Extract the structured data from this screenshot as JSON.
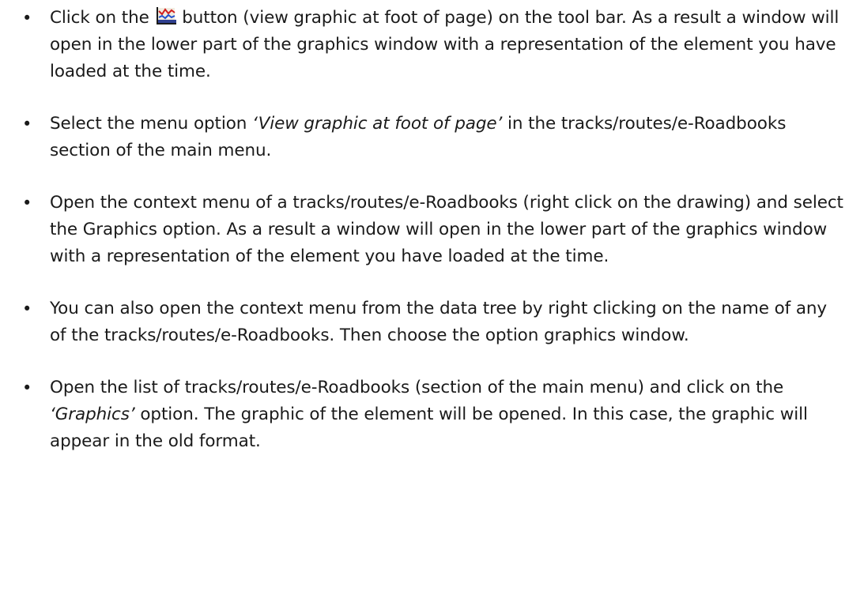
{
  "bullet_char": "•",
  "items": [
    {
      "a": "Click on the ",
      "icon": "graphic-profile-icon",
      "b": " button (view graphic at foot of page) on the tool bar. As a result a window will open in the lower part of the graphics window with a representation of the element you have loaded at the time."
    },
    {
      "a": "Select the menu option ",
      "em": "‘View graphic at foot of page’",
      "b": " in the tracks/routes/e-Roadbooks section of the main menu."
    },
    {
      "a": "Open the context menu of a tracks/routes/e-Roadbooks (right click on the drawing) and select the Graphics option. As a result a window will open in the lower part of the graphics window with a representation of the element you have loaded at the time."
    },
    {
      "a": "You can also open the context menu from the data tree by right clicking on the name of any of the tracks/routes/e-Roadbooks. Then choose the option graphics window."
    },
    {
      "a": "Open the list of tracks/routes/e-Roadbooks (section of the main menu) and click on the ",
      "em": "‘Graphics’",
      "b": " option. The graphic of the element will be opened. In this case, the graphic will appear in the old format."
    }
  ]
}
